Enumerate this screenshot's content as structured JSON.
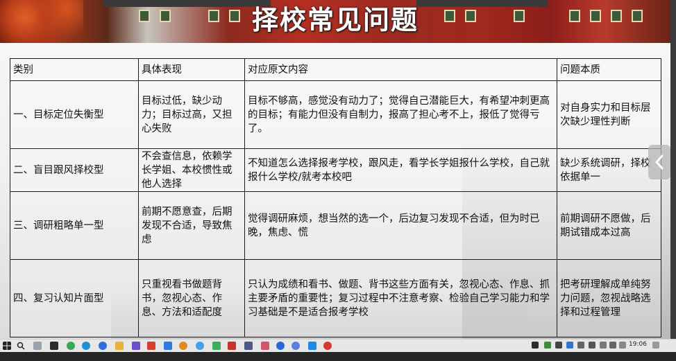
{
  "slide": {
    "title": "择校常见问题",
    "table": {
      "headers": [
        "类别",
        "具体表现",
        "对应原文内容",
        "问题本质"
      ],
      "rows": [
        [
          "一、目标定位失衡型",
          "目标过低，缺少动力；目标过高，又担心失败",
          "目标不够高，感觉没有动力了；觉得自己潜能巨大，有希望冲刺更高的目标；有能力但没有自制力，报高了担心考不上，报低了觉得亏了。",
          "对自身实力和目标层次缺少理性判断"
        ],
        [
          "二、盲目跟风择校型",
          "不会查信息，依赖学长学姐、本校惯性或他人选择",
          "不知道怎么选择报考学校，跟风走，看学长学姐报什么学校，自己就报什么学校/就考本校吧",
          "缺少系统调研，择校依据单一"
        ],
        [
          "三、调研粗略单一型",
          "前期不愿意查，后期发现不合适，导致焦虑",
          "觉得调研麻烦，想当然的选一个，后边复习发现不合适，但为时已晚，焦虑、慌",
          "前期调研不愿做，后期试错成本过高"
        ],
        [
          "四、复习认知片面型",
          "只重视看书做题背书，忽视心态、作息、方法和适配度",
          "只认为成绩和看书、做题、背书这些方面有关，忽视心态、作息、抓主要矛盾的重要性；复习过程中不注意考察、检验自己学习能力和学习基础是不是适合报考学校",
          "把考研理解成单纯努力问题，忽视战略选择和过程管理"
        ]
      ]
    }
  },
  "side_nav": {
    "icon": "chevron-left-icon"
  },
  "taskbar": {
    "clock": "19:06",
    "icons": [
      "windows-start-icon",
      "search-icon",
      "task-view-icon",
      "app-icon",
      "wechat-icon",
      "edge-icon",
      "browser-icon",
      "folder-icon",
      "app-icon",
      "wps-icon",
      "app-icon",
      "search-app-icon",
      "chat-icon",
      "app-icon",
      "pdf-icon",
      "app-icon",
      "app-icon",
      "app-icon",
      "app-icon",
      "app-icon"
    ]
  }
}
